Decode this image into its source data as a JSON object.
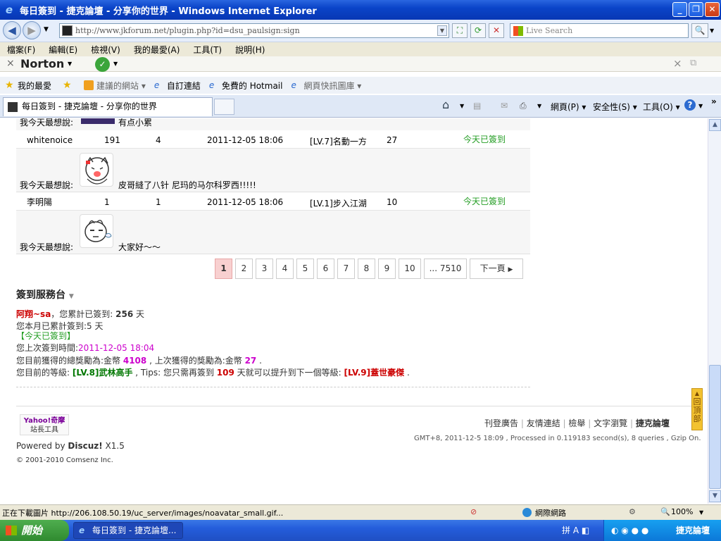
{
  "window": {
    "title": "每日簽到 - 捷克論壇 - 分享你的世界 - Windows Internet Explorer"
  },
  "address": {
    "url": "http://www.jkforum.net/plugin.php?id=dsu_paulsign:sign",
    "search_placeholder": "Live Search"
  },
  "menu": [
    "檔案(F)",
    "編輯(E)",
    "檢視(V)",
    "我的最愛(A)",
    "工具(T)",
    "說明(H)"
  ],
  "norton": {
    "label": "Norton"
  },
  "favbar": {
    "favorites": "我的最愛",
    "items": [
      "建議的網站 ▾",
      "自訂連結",
      "免費的 Hotmail",
      "網頁快訊圖庫 ▾"
    ]
  },
  "tab": {
    "title": "每日簽到 - 捷克論壇 - 分享你的世界"
  },
  "commandbar": {
    "page": "網頁(P) ▾",
    "safety": "安全性(S) ▾",
    "tools": "工具(O) ▾"
  },
  "rows": [
    {
      "name": "whitenoice",
      "days": "191",
      "month": "4",
      "time": "2011-12-05 18:06",
      "level": "[LV.7]名動一方",
      "reward": "27",
      "status": "今天已簽到",
      "msg_label": "我今天最想說:",
      "msg": "皮哥縫了八针 尼玛的马尔科罗西!!!!!"
    },
    {
      "name": "李明陽",
      "days": "1",
      "month": "1",
      "time": "2011-12-05 18:06",
      "level": "[LV.1]步入江湖",
      "reward": "10",
      "status": "今天已簽到",
      "msg_label": "我今天最想說:",
      "msg": "大家好～～"
    }
  ],
  "partial_row": {
    "label": "我今天最想說:",
    "msg": "有点小累"
  },
  "pagination": {
    "pages": [
      "1",
      "2",
      "3",
      "4",
      "5",
      "6",
      "7",
      "8",
      "9",
      "10",
      "... 7510"
    ],
    "next": "下一頁",
    "current": "1"
  },
  "service": {
    "title": "簽到服務台",
    "user": "阿翔~sa",
    "total_prefix": "，您累計已簽到: ",
    "total_days": "256",
    "day_unit": " 天",
    "month_text": "您本月已累計簽到:5 天",
    "today": "【今天已簽到】",
    "last_time_label": "您上次簽到時間:",
    "last_time": "2011-12-05 18:04",
    "reward_prefix": "您目前獲得的總獎勵為:金幣 ",
    "reward_total": "4108",
    "reward_mid": " , 上次獲得的獎勵為:金幣 ",
    "reward_last": "27",
    "reward_end": " .",
    "level_prefix": "您目前的等級: ",
    "level_cur": "[LV.8]武林高手",
    "level_mid": " , Tips: 您只需再簽到 ",
    "level_days": "109",
    "level_mid2": " 天就可以提升到下一個等級: ",
    "level_next": "[LV.9]蓋世豪傑",
    "level_end": " ."
  },
  "footer": {
    "yahoo1": "Yahoo!奇摩",
    "yahoo2": "站長工具",
    "powered_prefix": "Powered by ",
    "discuz": "Discuz!",
    "version": " X1.5",
    "copyright": "© 2001-2010 Comsenz Inc.",
    "links": [
      "刊登廣告",
      "友情連結",
      "檢舉",
      "文字瀏覽",
      "捷克論壇"
    ],
    "gmt": "GMT+8, 2011-12-5 18:09 , Processed in 0.119183 second(s), 8 queries , Gzip On.",
    "backtop": "回頂部"
  },
  "statusbar": {
    "text": "正在下載圖片 http://206.108.50.19/uc_server/images/noavatar_small.gif...",
    "zone": "網際網路",
    "zoom": "100%"
  },
  "taskbar": {
    "start": "開始",
    "task": "每日簽到 - 捷克論壇...",
    "tray": "捷克論壇"
  },
  "colors": {
    "titlebar": "#0a44c8",
    "signed_green": "#239d23",
    "page_current": "#f8d0d0"
  }
}
